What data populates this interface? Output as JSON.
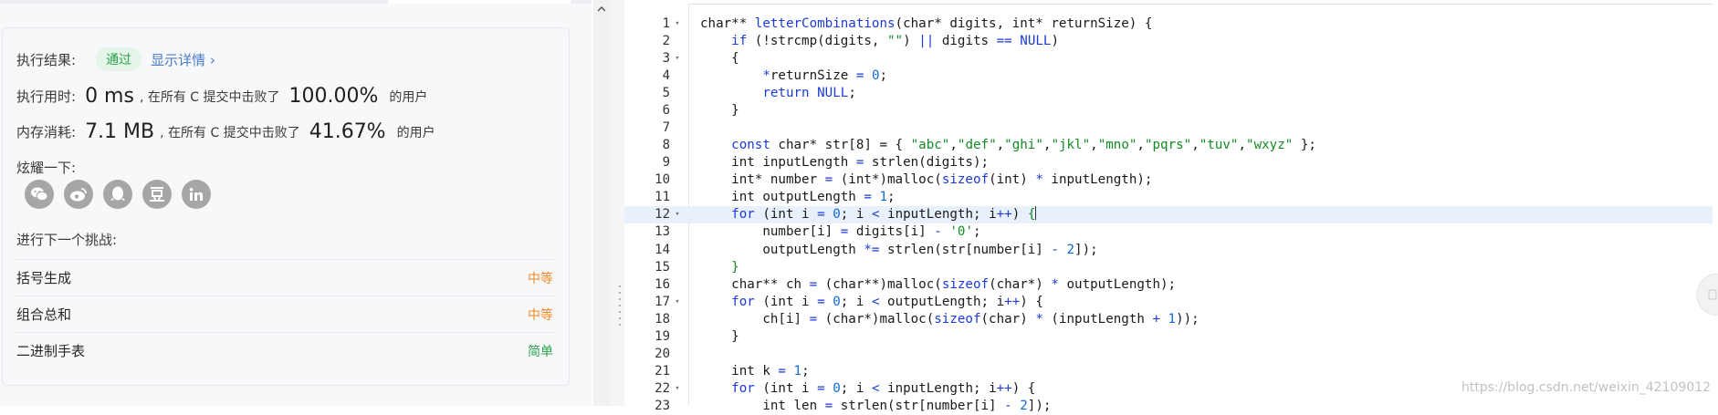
{
  "result": {
    "label": "执行结果:",
    "status": "通过",
    "detail_link": "显示详情 ›",
    "runtime_label": "执行用时:",
    "runtime_value": "0 ms",
    "runtime_beat_text": ", 在所有 C 提交中击败了",
    "runtime_percent": "100.00%",
    "users_suffix": "的用户",
    "memory_label": "内存消耗:",
    "memory_value": "7.1 MB",
    "memory_beat_text": ", 在所有 C 提交中击败了",
    "memory_percent": "41.67%",
    "share_label": "炫耀一下:",
    "social_icons": [
      "wechat-icon",
      "weibo-icon",
      "qq-icon",
      "douban-icon",
      "linkedin-icon"
    ],
    "next_challenge_label": "进行下一个挑战:",
    "challenges": [
      {
        "name": "括号生成",
        "difficulty": "中等"
      },
      {
        "name": "组合总和",
        "difficulty": "中等"
      },
      {
        "name": "二进制手表",
        "difficulty": "简单"
      }
    ]
  },
  "colors": {
    "pass_green": "#2aa24c",
    "medium_orange": "#f08a24",
    "keyword_blue": "#1c3ad6",
    "string_green": "#118b23",
    "active_line": "#e8f0fc"
  },
  "editor": {
    "active_line": 12,
    "lines": [
      {
        "n": "1",
        "fold": true
      },
      {
        "n": "2",
        "fold": false
      },
      {
        "n": "3",
        "fold": true
      },
      {
        "n": "4",
        "fold": false
      },
      {
        "n": "5",
        "fold": false
      },
      {
        "n": "6",
        "fold": false
      },
      {
        "n": "7",
        "fold": false
      },
      {
        "n": "8",
        "fold": false
      },
      {
        "n": "9",
        "fold": false
      },
      {
        "n": "10",
        "fold": false
      },
      {
        "n": "11",
        "fold": false
      },
      {
        "n": "12",
        "fold": true
      },
      {
        "n": "13",
        "fold": false
      },
      {
        "n": "14",
        "fold": false
      },
      {
        "n": "15",
        "fold": false
      },
      {
        "n": "16",
        "fold": false
      },
      {
        "n": "17",
        "fold": true
      },
      {
        "n": "18",
        "fold": false
      },
      {
        "n": "19",
        "fold": false
      },
      {
        "n": "20",
        "fold": false
      },
      {
        "n": "21",
        "fold": false
      },
      {
        "n": "22",
        "fold": true
      },
      {
        "n": "23",
        "fold": false
      }
    ],
    "code": {
      "l1": [
        "char** ",
        "letterCombinations",
        "(char* digits, int* returnSize) {"
      ],
      "l2": [
        "    ",
        "if",
        " (!strcmp(digits, ",
        "\"\"",
        ") ",
        "||",
        " digits ",
        "==",
        " ",
        "NULL",
        ")"
      ],
      "l3": [
        "    {"
      ],
      "l4": [
        "        ",
        "*",
        "returnSize ",
        "=",
        " ",
        "0",
        ";"
      ],
      "l5": [
        "        ",
        "return",
        " ",
        "NULL",
        ";"
      ],
      "l6": [
        "    }"
      ],
      "l7": [
        ""
      ],
      "l8": [
        "    ",
        "const",
        " char* str[8] = { ",
        "\"abc\"",
        ",",
        "\"def\"",
        ",",
        "\"ghi\"",
        ",",
        "\"jkl\"",
        ",",
        "\"mno\"",
        ",",
        "\"pqrs\"",
        ",",
        "\"tuv\"",
        ",",
        "\"wxyz\"",
        " };"
      ],
      "l9": [
        "    int inputLength ",
        "=",
        " strlen(digits);"
      ],
      "l10": [
        "    int* number ",
        "=",
        " (int*)malloc(",
        "sizeof",
        "(int) ",
        "*",
        " inputLength);"
      ],
      "l11": [
        "    int outputLength ",
        "=",
        " ",
        "1",
        ";"
      ],
      "l12": [
        "    ",
        "for",
        " (int i ",
        "=",
        " ",
        "0",
        "; i ",
        "<",
        " inputLength; i",
        "++",
        ") ",
        "{"
      ],
      "l13": [
        "        number[i] ",
        "=",
        " digits[i] ",
        "-",
        " ",
        "'0'",
        ";"
      ],
      "l14": [
        "        outputLength ",
        "*=",
        " strlen(str[number[i] ",
        "-",
        " ",
        "2",
        "]);"
      ],
      "l15": [
        "    ",
        "}"
      ],
      "l16": [
        "    char** ch ",
        "=",
        " (char**)malloc(",
        "sizeof",
        "(char*) ",
        "*",
        " outputLength);"
      ],
      "l17": [
        "    ",
        "for",
        " (int i ",
        "=",
        " ",
        "0",
        "; i ",
        "<",
        " outputLength; i",
        "++",
        ") {"
      ],
      "l18": [
        "        ch[i] ",
        "=",
        " (char*)malloc(",
        "sizeof",
        "(char) ",
        "*",
        " (inputLength ",
        "+",
        " ",
        "1",
        "));"
      ],
      "l19": [
        "    }"
      ],
      "l20": [
        ""
      ],
      "l21": [
        "    int k ",
        "=",
        " ",
        "1",
        ";"
      ],
      "l22": [
        "    ",
        "for",
        " (int i ",
        "=",
        " ",
        "0",
        "; i ",
        "<",
        " inputLength; i",
        "++",
        ") {"
      ],
      "l23": [
        "        int len ",
        "=",
        " strlen(str[number[i] ",
        "-",
        " ",
        "2",
        "]);"
      ]
    }
  },
  "watermark": "https://blog.csdn.net/weixin_42109012"
}
